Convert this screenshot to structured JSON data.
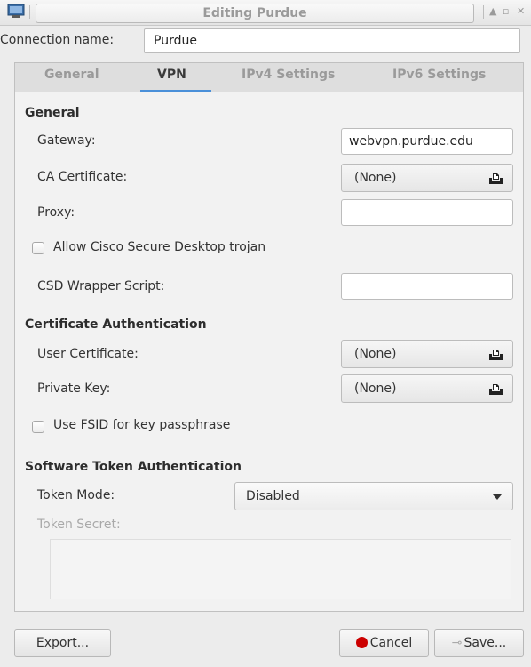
{
  "window": {
    "title": "Editing Purdue",
    "controls": [
      "▲",
      "▫",
      "✕"
    ]
  },
  "connection": {
    "label": "Connection name:",
    "value": "Purdue"
  },
  "tabs": [
    {
      "label": "General",
      "active": false
    },
    {
      "label": "VPN",
      "active": true
    },
    {
      "label": "IPv4 Settings",
      "active": false
    },
    {
      "label": "IPv6 Settings",
      "active": false
    }
  ],
  "general": {
    "heading": "General",
    "gateway_label": "Gateway:",
    "gateway_value": "webvpn.purdue.edu",
    "ca_label": "CA Certificate:",
    "ca_value": "(None)",
    "proxy_label": "Proxy:",
    "proxy_value": "",
    "csd_check_label": "Allow Cisco Secure Desktop trojan",
    "csd_checked": false,
    "csd_wrapper_label": "CSD Wrapper Script:",
    "csd_wrapper_value": ""
  },
  "cert_auth": {
    "heading": "Certificate Authentication",
    "user_cert_label": "User Certificate:",
    "user_cert_value": "(None)",
    "private_key_label": "Private Key:",
    "private_key_value": "(None)",
    "fsid_label": "Use FSID for key passphrase",
    "fsid_checked": false
  },
  "token_auth": {
    "heading": "Software Token Authentication",
    "mode_label": "Token Mode:",
    "mode_value": "Disabled",
    "secret_label": "Token Secret:",
    "secret_value": ""
  },
  "buttons": {
    "export": "Export...",
    "cancel": "Cancel",
    "save": "Save..."
  },
  "colors": {
    "tab_underline": "#4a90d9",
    "cancel_icon": "#cc0000"
  }
}
